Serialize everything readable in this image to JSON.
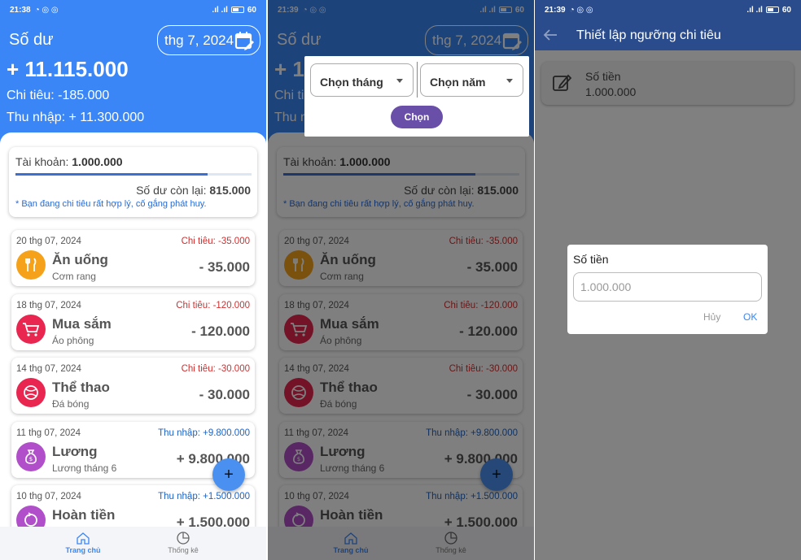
{
  "colors": {
    "primary": "#3a86f6",
    "expense": "#d32f2f",
    "income": "#1e63c2",
    "chon_button": "#6a4fa8"
  },
  "screen1": {
    "status": {
      "time": "21:38",
      "battery": "60"
    },
    "header": {
      "title": "Số dư",
      "month": "thg 7, 2024",
      "total": "+ 11.115.000",
      "expense": "Chi tiêu: -185.000",
      "income": "Thu nhập: + 11.300.000"
    },
    "account": {
      "label": "Tài khoản:",
      "value": "1.000.000",
      "remain_label": "Số dư còn lại:",
      "remain_value": "815.000",
      "note": "* Bạn đang chi tiêu rất hợp lý, cố gắng phát huy.",
      "progress": 0.815
    },
    "transactions": [
      {
        "date": "20 thg 07, 2024",
        "kind": "Chi tiêu: -35.000",
        "type": "expense",
        "name": "Ăn uống",
        "sub": "Cơm rang",
        "amount": "- 35.000",
        "icon": "utensils-icon",
        "icon_color": "#f5a21a"
      },
      {
        "date": "18 thg 07, 2024",
        "kind": "Chi tiêu: -120.000",
        "type": "expense",
        "name": "Mua sắm",
        "sub": "Áo phông",
        "amount": "- 120.000",
        "icon": "cart-icon",
        "icon_color": "#e8264f"
      },
      {
        "date": "14 thg 07, 2024",
        "kind": "Chi tiêu: -30.000",
        "type": "expense",
        "name": "Thể thao",
        "sub": "Đá bóng",
        "amount": "- 30.000",
        "icon": "ball-icon",
        "icon_color": "#e8264f"
      },
      {
        "date": "11 thg 07, 2024",
        "kind": "Thu nhập: +9.800.000",
        "type": "income",
        "name": "Lương",
        "sub": "Lương tháng 6",
        "amount": "+ 9.800.000",
        "icon": "money-bag-icon",
        "icon_color": "#b04fc9"
      },
      {
        "date": "10 thg 07, 2024",
        "kind": "Thu nhập: +1.500.000",
        "type": "income",
        "name": "Hoàn tiền",
        "sub": "",
        "amount": "+ 1.500.000",
        "icon": "refund-icon",
        "icon_color": "#b04fc9"
      }
    ],
    "fab": "+",
    "nav": {
      "home": "Trang chủ",
      "stats": "Thống kê"
    }
  },
  "screen2": {
    "status": {
      "time": "21:39",
      "battery": "60"
    },
    "picker": {
      "month_placeholder": "Chọn tháng",
      "year_placeholder": "Chọn năm",
      "button": "Chọn"
    }
  },
  "screen3": {
    "status": {
      "time": "21:39",
      "battery": "60"
    },
    "title": "Thiết lập ngưỡng chi tiêu",
    "row": {
      "label": "Số tiền",
      "value": "1.000.000"
    },
    "dialog": {
      "title": "Số tiền",
      "input_value": "1.000.000",
      "cancel": "Hủy",
      "ok": "OK"
    }
  }
}
